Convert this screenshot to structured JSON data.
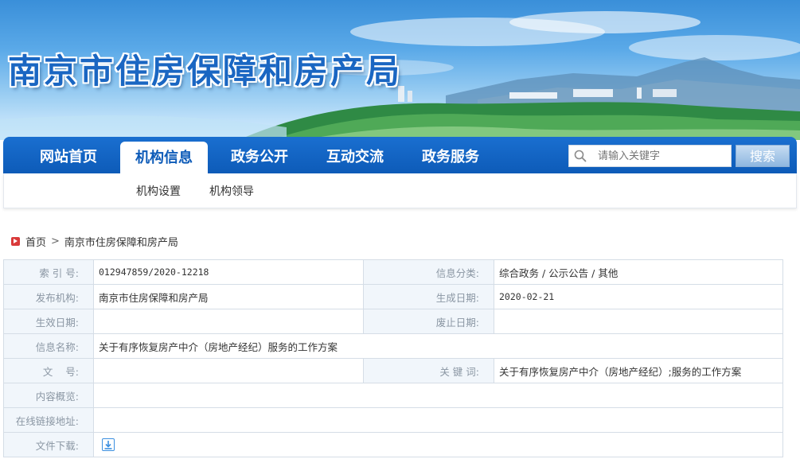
{
  "header": {
    "site_title": "南京市住房保障和房产局"
  },
  "nav": {
    "items": [
      {
        "label": "网站首页",
        "active": false
      },
      {
        "label": "机构信息",
        "active": true
      },
      {
        "label": "政务公开",
        "active": false
      },
      {
        "label": "互动交流",
        "active": false
      },
      {
        "label": "政务服务",
        "active": false
      }
    ],
    "search": {
      "placeholder": "请输入关键字",
      "button_label": "搜索",
      "icon": "search-icon"
    }
  },
  "subnav": {
    "items": [
      {
        "label": "机构设置"
      },
      {
        "label": "机构领导"
      }
    ]
  },
  "breadcrumb": {
    "home": "首页",
    "separator": ">",
    "current": "南京市住房保障和房产局"
  },
  "info": {
    "index_label": "索 引 号:",
    "index_value": "012947859/2020-12218",
    "category_label": "信息分类:",
    "category_value": "综合政务 / 公示公告 / 其他",
    "publisher_label": "发布机构:",
    "publisher_value": "南京市住房保障和房产局",
    "created_label": "生成日期:",
    "created_value": "2020-02-21",
    "effective_label": "生效日期:",
    "effective_value": "",
    "abolished_label": "废止日期:",
    "abolished_value": "",
    "name_label": "信息名称:",
    "name_value": "关于有序恢复房产中介（房地产经纪）服务的工作方案",
    "docno_label": "文    号:",
    "docno_value": "",
    "keywords_label": "关 键 词:",
    "keywords_value": "关于有序恢复房产中介（房地产经纪）;服务的工作方案",
    "summary_label": "内容概览:",
    "summary_value": "",
    "link_label": "在线链接地址:",
    "link_value": "",
    "download_label": "文件下载:",
    "download_icon": "download-icon"
  },
  "colors": {
    "nav_blue": "#0d5bb8",
    "label_bg": "#f1f6fb",
    "breadcrumb_icon": "#d93a3a"
  }
}
